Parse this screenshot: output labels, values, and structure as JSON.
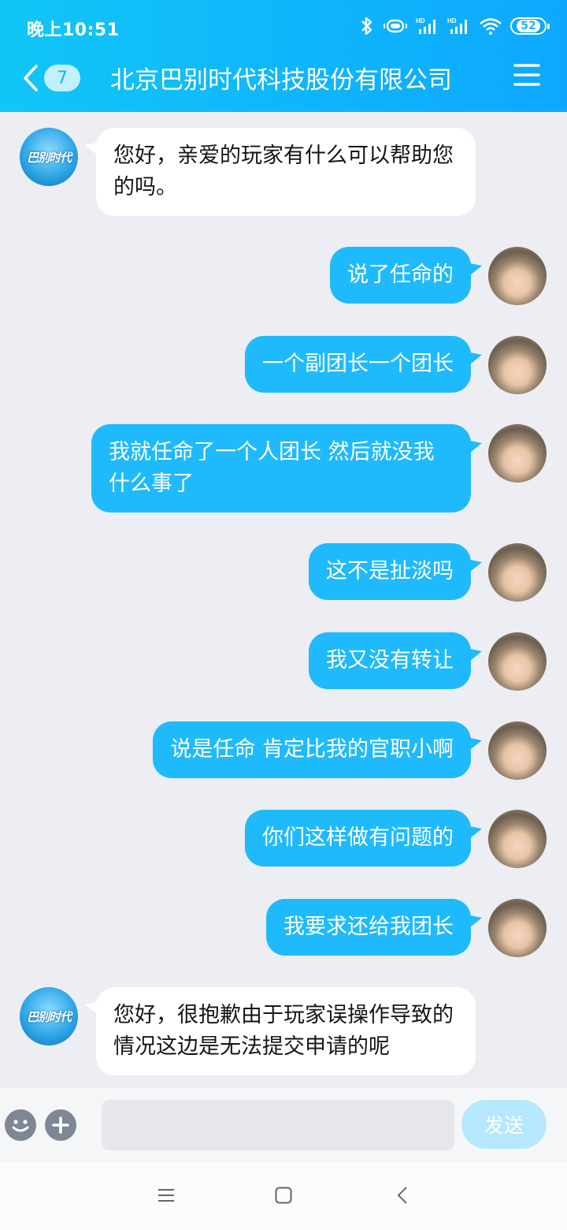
{
  "status_bar": {
    "time": "晚上10:51",
    "battery": "52",
    "network_label": "HD"
  },
  "header": {
    "unread_count": "7",
    "title": "北京巴别时代科技股份有限公司"
  },
  "company": {
    "avatar_text": "巴别时代"
  },
  "messages": [
    {
      "from": "company",
      "text": "您好，亲爱的玩家有什么可以帮助您的吗。"
    },
    {
      "from": "user",
      "text": "说了任命的"
    },
    {
      "from": "user",
      "text": "一个副团长一个团长"
    },
    {
      "from": "user",
      "text": "我就任命了一个人团长 然后就没我什么事了"
    },
    {
      "from": "user",
      "text": "这不是扯淡吗"
    },
    {
      "from": "user",
      "text": "我又没有转让"
    },
    {
      "from": "user",
      "text": "说是任命 肯定比我的官职小啊"
    },
    {
      "from": "user",
      "text": "你们这样做有问题的"
    },
    {
      "from": "user",
      "text": "我要求还给我团长"
    },
    {
      "from": "company",
      "text": "您好，很抱歉由于玩家误操作导致的情况这边是无法提交申请的呢"
    }
  ],
  "input": {
    "placeholder": "",
    "send_label": "发送"
  },
  "icons": {
    "emoji": "emoji-icon",
    "plus": "plus-icon",
    "back": "chevron-left-icon",
    "menu": "hamburger-menu-icon"
  },
  "colors": {
    "brand": "#12b8fa",
    "bubble_out": "#1fbafc",
    "bubble_in": "#ffffff",
    "chat_bg": "#eceef3"
  }
}
